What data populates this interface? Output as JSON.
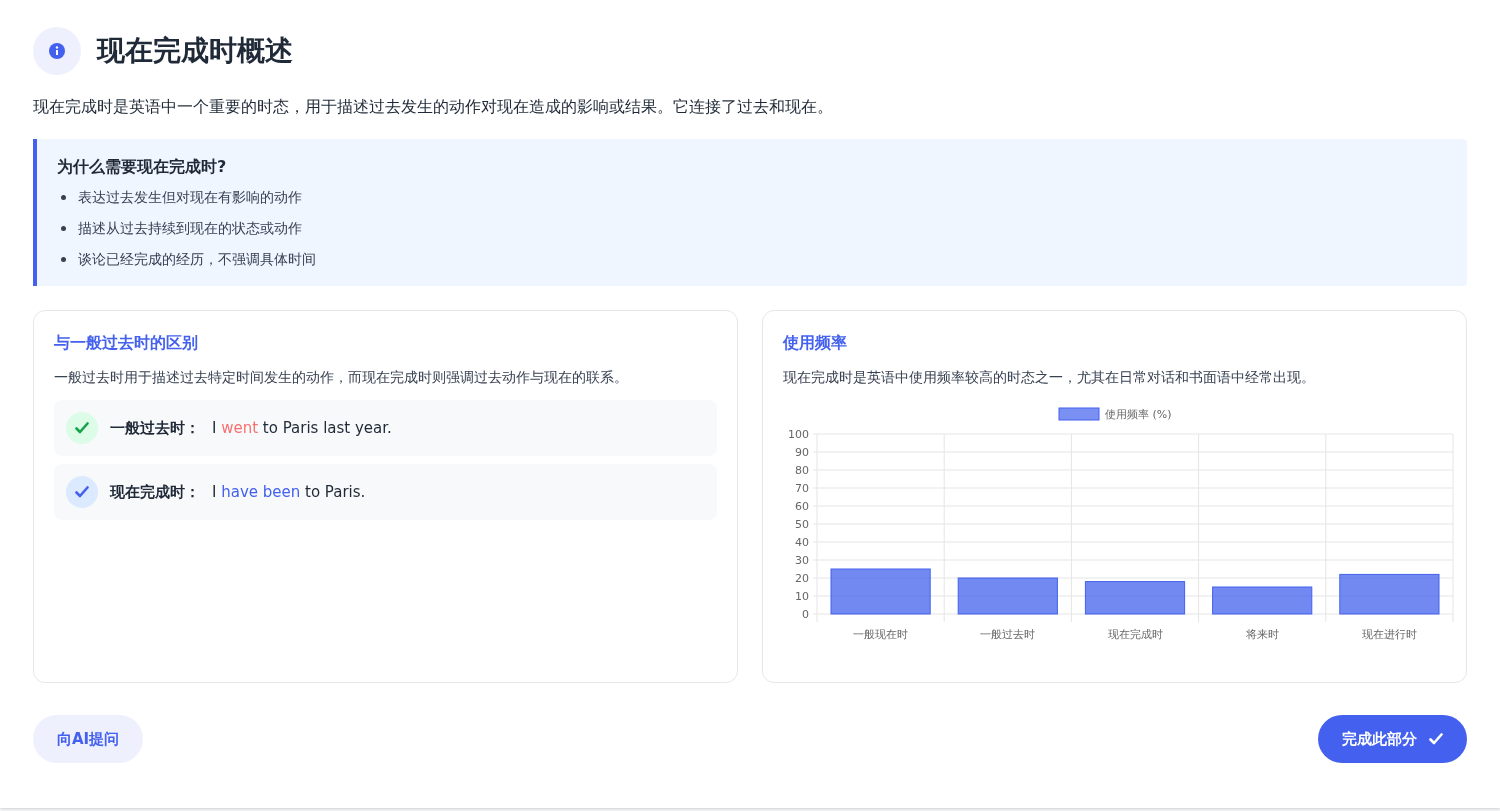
{
  "header": {
    "title": "现在完成时概述"
  },
  "intro": "现在完成时是英语中一个重要的时态，用于描述过去发生的动作对现在造成的影响或结果。它连接了过去和现在。",
  "callout": {
    "title": "为什么需要现在完成时?",
    "items": [
      "表达过去发生但对现在有影响的动作",
      "描述从过去持续到现在的状态或动作",
      "谈论已经完成的经历，不强调具体时间"
    ]
  },
  "difference_card": {
    "title": "与一般过去时的区别",
    "description": "一般过去时用于描述过去特定时间发生的动作，而现在完成时则强调过去动作与现在的联系。",
    "examples": [
      {
        "kind": "past",
        "label": "一般过去时：",
        "segments": [
          {
            "text": "I ",
            "highlight": false
          },
          {
            "text": "went",
            "highlight": true
          },
          {
            "text": " to Paris last year.",
            "highlight": false
          }
        ]
      },
      {
        "kind": "perfect",
        "label": "现在完成时：",
        "segments": [
          {
            "text": "I ",
            "highlight": false
          },
          {
            "text": "have been",
            "highlight": true
          },
          {
            "text": " to Paris.",
            "highlight": false
          }
        ]
      }
    ]
  },
  "frequency_card": {
    "title": "使用频率",
    "description": "现在完成时是英语中使用频率较高的时态之一，尤其在日常对话和书面语中经常出现。",
    "chart_data": {
      "type": "bar",
      "categories": [
        "一般现在时",
        "一般过去时",
        "现在完成时",
        "将来时",
        "现在进行时"
      ],
      "series": [
        {
          "name": "使用频率 (%)",
          "color": "#4361ee",
          "values": [
            25,
            20,
            18,
            15,
            22
          ]
        }
      ],
      "grid": true,
      "ylim": [
        0,
        100
      ],
      "yticks": [
        0,
        10,
        20,
        30,
        40,
        50,
        60,
        70,
        80,
        90,
        100
      ]
    }
  },
  "footer": {
    "ask_button": "向AI提问",
    "complete_button": "完成此部分"
  }
}
